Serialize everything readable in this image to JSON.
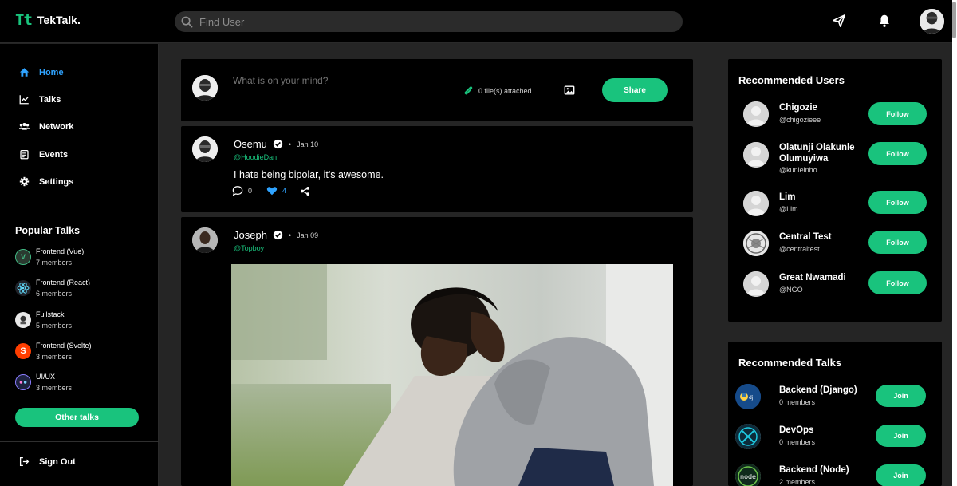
{
  "app": {
    "logo_mark": "Tt",
    "name": "TekTalk."
  },
  "search": {
    "placeholder": "Find User"
  },
  "sidebar": {
    "items": [
      {
        "label": "Home",
        "active": true
      },
      {
        "label": "Talks"
      },
      {
        "label": "Network"
      },
      {
        "label": "Events"
      },
      {
        "label": "Settings"
      }
    ],
    "popular_title": "Popular Talks",
    "popular": [
      {
        "name": "Frontend (Vue)",
        "members": "7 members"
      },
      {
        "name": "Frontend (React)",
        "members": "6 members"
      },
      {
        "name": "Fullstack",
        "members": "5 members"
      },
      {
        "name": "Frontend (Svelte)",
        "members": "3 members"
      },
      {
        "name": "UI/UX",
        "members": "3 members"
      }
    ],
    "other_talks_label": "Other talks",
    "sign_out_label": "Sign Out"
  },
  "composer": {
    "placeholder": "What is on your mind?",
    "attached": "0 file(s) attached",
    "share_label": "Share"
  },
  "posts": [
    {
      "name": "Osemu",
      "date": "Jan 10",
      "handle": "@HoodieDan",
      "text": "I hate being bipolar, it's awesome.",
      "comments": "0",
      "likes": "4"
    },
    {
      "name": "Joseph",
      "date": "Jan 09",
      "handle": "@Topboy"
    }
  ],
  "recommended_users": {
    "title": "Recommended Users",
    "follow_label": "Follow",
    "users": [
      {
        "name": "Chigozie",
        "handle": "@chigozieee"
      },
      {
        "name": "Olatunji Olakunle Olumuyiwa",
        "handle": "@kunleinho"
      },
      {
        "name": "Lim",
        "handle": "@Lim"
      },
      {
        "name": "Central Test",
        "handle": "@centraltest"
      },
      {
        "name": "Great Nwamadi",
        "handle": "@NGO"
      }
    ]
  },
  "recommended_talks": {
    "title": "Recommended Talks",
    "join_label": "Join",
    "talks": [
      {
        "name": "Backend (Django)",
        "members": "0 members"
      },
      {
        "name": "DevOps",
        "members": "0 members"
      },
      {
        "name": "Backend (Node)",
        "members": "2 members"
      }
    ]
  },
  "colors": {
    "accent": "#19c37d",
    "active": "#2fa3ff",
    "background": "#252525",
    "card": "#000000"
  }
}
